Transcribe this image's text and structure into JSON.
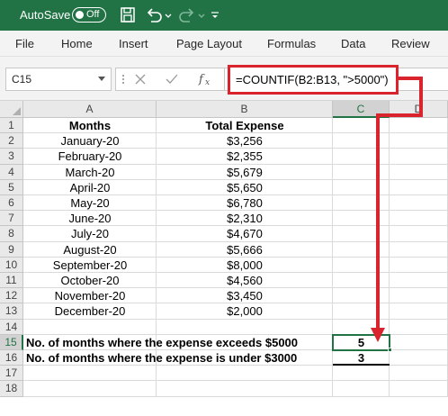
{
  "titlebar": {
    "autosave_label": "AutoSave",
    "autosave_state": "Off",
    "icons": [
      "save-icon",
      "undo-icon",
      "undo-dropdown-icon",
      "redo-icon",
      "redo-dropdown-icon",
      "customize-toolbar-icon"
    ],
    "background_color": "#217346"
  },
  "menu": [
    "File",
    "Home",
    "Insert",
    "Page Layout",
    "Formulas",
    "Data",
    "Review"
  ],
  "formula_bar": {
    "name_box": "C15",
    "icons": [
      "more-options-icon",
      "cancel-icon",
      "enter-icon",
      "insert-function-icon"
    ],
    "formula": "=COUNTIF(B2:B13, \">5000\")",
    "highlight_color": "#d9242e"
  },
  "columns": [
    "A",
    "B",
    "C",
    "D"
  ],
  "rows": [
    "1",
    "2",
    "3",
    "4",
    "5",
    "6",
    "7",
    "8",
    "9",
    "10",
    "11",
    "12",
    "13",
    "14",
    "15",
    "16",
    "17",
    "18"
  ],
  "table": {
    "headers": [
      "Months",
      "Total Expense"
    ],
    "data": [
      [
        "January-20",
        "$3,256"
      ],
      [
        "February-20",
        "$2,355"
      ],
      [
        "March-20",
        "$5,679"
      ],
      [
        "April-20",
        "$5,650"
      ],
      [
        "May-20",
        "$6,780"
      ],
      [
        "June-20",
        "$2,310"
      ],
      [
        "July-20",
        "$4,670"
      ],
      [
        "August-20",
        "$5,666"
      ],
      [
        "September-20",
        "$8,000"
      ],
      [
        "October-20",
        "$4,560"
      ],
      [
        "November-20",
        "$3,450"
      ],
      [
        "December-20",
        "$2,000"
      ]
    ]
  },
  "summary": [
    {
      "label": "No. of months where the expense exceeds $5000",
      "value": "5"
    },
    {
      "label": "No. of months where the expense is under $3000",
      "value": "3"
    }
  ],
  "selection": {
    "cell": "C15",
    "color": "#217346"
  }
}
